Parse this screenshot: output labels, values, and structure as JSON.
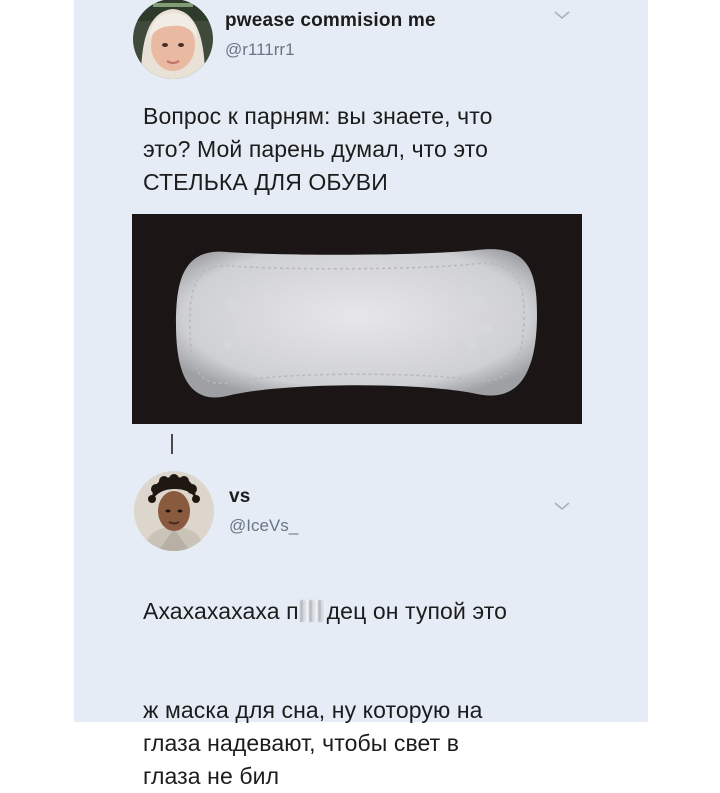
{
  "tweet1": {
    "display_name": "pwease commision me",
    "handle": "@r111rr1",
    "text": "Вопрос к парням: вы знаете, что\nэто? Мой парень думал, что это\nСТЕЛЬКА ДЛЯ ОБУВИ",
    "menu_icon": "chevron-down-icon"
  },
  "tweet2": {
    "display_name": "vs",
    "handle": "@IceVs_",
    "text_part1": "Ахахахахаха п",
    "text_part2": "дец он тупой это",
    "text_rest": "ж маска для сна, ну которую на\nглаза надевают, чтобы свет в\nглаза не бил",
    "menu_icon": "chevron-down-icon"
  },
  "colors": {
    "card_background": "#e6ecf5",
    "text": "#1c1c1c",
    "handle": "#687686",
    "photo_background": "#1b1516"
  }
}
